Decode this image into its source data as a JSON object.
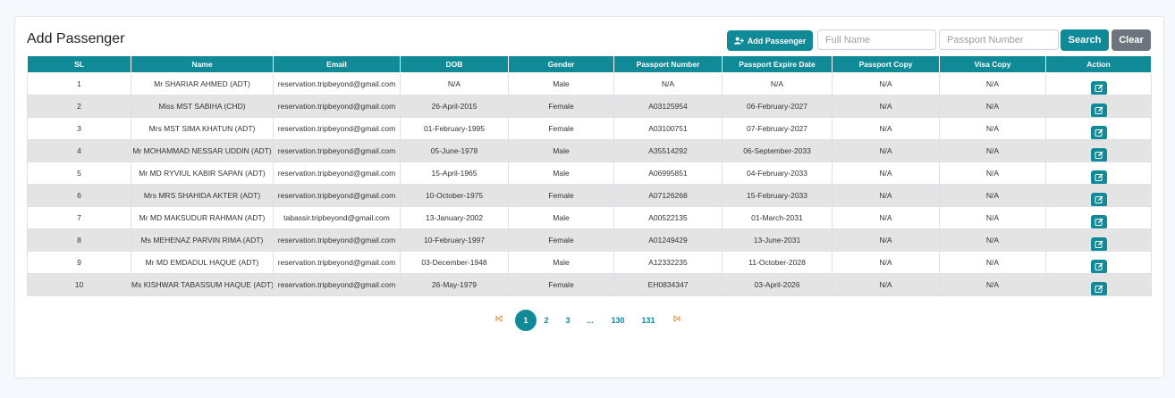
{
  "page": {
    "title": "Add Passenger"
  },
  "toolbar": {
    "add_label": "Add Passenger",
    "full_name_placeholder": "Full Name",
    "passport_placeholder": "Passport Number",
    "search_label": "Search",
    "clear_label": "Clear"
  },
  "table": {
    "headers": [
      "SL",
      "Name",
      "Email",
      "DOB",
      "Gender",
      "Passport Number",
      "Passport Expire Date",
      "Passport Copy",
      "Visa Copy",
      "Action"
    ],
    "rows": [
      [
        "1",
        "Mr SHARIAR AHMED (ADT)",
        "reservation.tripbeyond@gmail.com",
        "N/A",
        "Male",
        "N/A",
        "N/A",
        "N/A",
        "N/A"
      ],
      [
        "2",
        "Miss MST SABIHA (CHD)",
        "reservation.tripbeyond@gmail.com",
        "26-April-2015",
        "Female",
        "A03125954",
        "06-February-2027",
        "N/A",
        "N/A"
      ],
      [
        "3",
        "Mrs MST SIMA KHATUN (ADT)",
        "reservation.tripbeyond@gmail.com",
        "01-February-1995",
        "Female",
        "A03100751",
        "07-February-2027",
        "N/A",
        "N/A"
      ],
      [
        "4",
        "Mr MOHAMMAD NESSAR UDDIN (ADT)",
        "reservation.tripbeyond@gmail.com",
        "05-June-1978",
        "Male",
        "A35514292",
        "06-September-2033",
        "N/A",
        "N/A"
      ],
      [
        "5",
        "Mr MD RYVIUL KABIR SAPAN (ADT)",
        "reservation.tripbeyond@gmail.com",
        "15-April-1965",
        "Male",
        "A06995851",
        "04-February-2033",
        "N/A",
        "N/A"
      ],
      [
        "6",
        "Mrs MRS SHAHIDA AKTER (ADT)",
        "reservation.tripbeyond@gmail.com",
        "10-October-1975",
        "Female",
        "A07126268",
        "15-February-2033",
        "N/A",
        "N/A"
      ],
      [
        "7",
        "Mr MD MAKSUDUR RAHMAN (ADT)",
        "tabassir.tripbeyond@gmail.com",
        "13-January-2002",
        "Male",
        "A00522135",
        "01-March-2031",
        "N/A",
        "N/A"
      ],
      [
        "8",
        "Ms MEHENAZ PARVIN RIMA (ADT)",
        "reservation.tripbeyond@gmail.com",
        "10-February-1997",
        "Female",
        "A01249429",
        "13-June-2031",
        "N/A",
        "N/A"
      ],
      [
        "9",
        "Mr MD EMDADUL HAQUE (ADT)",
        "reservation.tripbeyond@gmail.com",
        "03-December-1948",
        "Male",
        "A12332235",
        "11-October-2028",
        "N/A",
        "N/A"
      ],
      [
        "10",
        "Ms KISHWAR TABASSUM HAQUE (ADT)",
        "reservation.tripbeyond@gmail.com",
        "26-May-1979",
        "Female",
        "EH0834347",
        "03-April-2026",
        "N/A",
        "N/A"
      ]
    ]
  },
  "pagination": {
    "first_icon": "first-page-icon",
    "pages": [
      "1",
      "2",
      "3",
      "...",
      "130",
      "131"
    ],
    "active": "1",
    "last_icon": "last-page-icon"
  },
  "colors": {
    "primary": "#118a98",
    "secondary": "#6c757d",
    "row_alt": "#e4e4e4",
    "nav": "#e08a3a"
  },
  "icons": {
    "add": "user-plus-icon",
    "edit": "edit-icon"
  }
}
